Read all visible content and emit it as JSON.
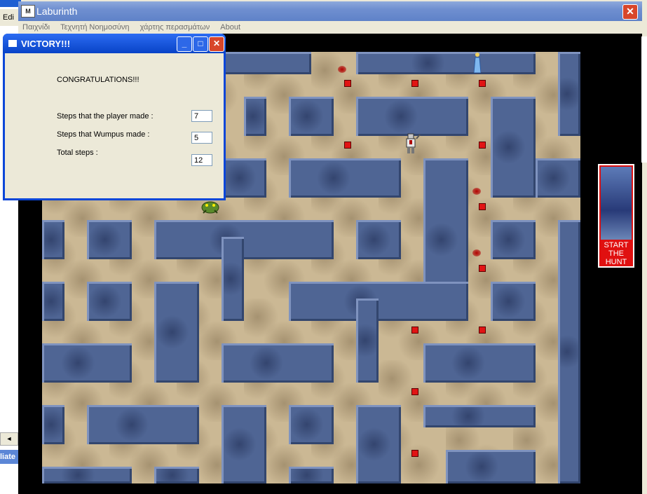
{
  "background_window": {
    "menu_fragment": "Edi",
    "status_fragment": "liate",
    "scroll_arrow": "◄"
  },
  "main_window": {
    "title": "Laburinth",
    "icon_text": "M",
    "close_glyph": "✕"
  },
  "menu": {
    "items": [
      "Παιχνίδι",
      "Τεχνητή Νοημοσύνη",
      "χάρτης περασμάτων",
      "About"
    ]
  },
  "hunt_card": {
    "text": [
      "START",
      "THE",
      "HUNT"
    ]
  },
  "dialog": {
    "title": "VICTORY!!!",
    "heading": "CONGRATULATIONS!!!",
    "player_steps_label": "Steps that the player made :",
    "player_steps_value": "7",
    "wumpus_steps_label": "Steps that Wumpus made :",
    "wumpus_steps_value": "5",
    "total_steps_label": "Total steps :",
    "total_steps_value": "12",
    "minimize_glyph": "_",
    "maximize_glyph": "□",
    "close_glyph": "✕"
  },
  "colors": {
    "wall": "#4f6594",
    "floor": "#cbb894",
    "marker": "#e11414",
    "title_bar": "#0843c7"
  }
}
